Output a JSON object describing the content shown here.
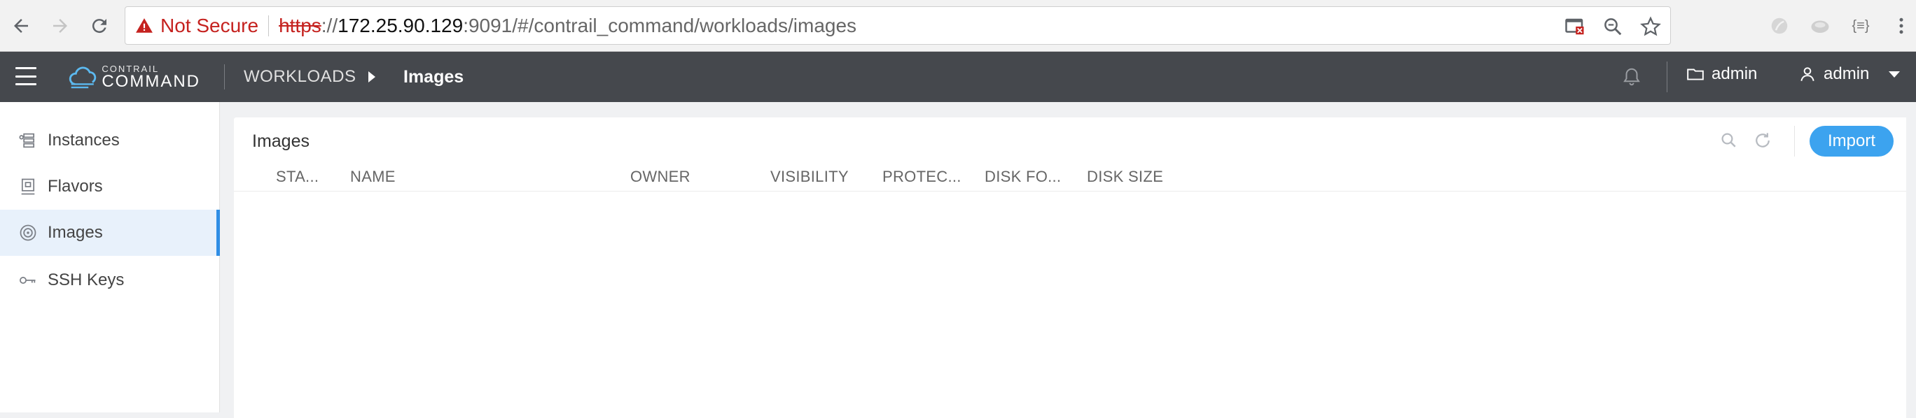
{
  "browser": {
    "security_label": "Not Secure",
    "url_scheme": "https",
    "url_sep": "://",
    "url_host": "172.25.90.129",
    "url_rest": ":9091/#/contrail_command/workloads/images",
    "ext_label": "{≡}"
  },
  "header": {
    "logo_top": "CONTRAIL",
    "logo_bottom": "COMMAND",
    "breadcrumb_parent": "WORKLOADS",
    "breadcrumb_current": "Images",
    "project": "admin",
    "user": "admin"
  },
  "sidebar": {
    "items": [
      {
        "label": "Instances",
        "icon": "instances-icon"
      },
      {
        "label": "Flavors",
        "icon": "flavors-icon"
      },
      {
        "label": "Images",
        "icon": "images-icon",
        "active": true
      },
      {
        "label": "SSH Keys",
        "icon": "key-icon"
      }
    ]
  },
  "main": {
    "title": "Images",
    "import_label": "Import",
    "columns": [
      "STA...",
      "NAME",
      "OWNER",
      "VISIBILITY",
      "PROTEC...",
      "DISK FO...",
      "DISK SIZE"
    ]
  },
  "colors": {
    "header_bg": "#45484d",
    "accent": "#3ca3ef",
    "active_bg": "#e8f1fb",
    "insecure": "#c5221f"
  }
}
